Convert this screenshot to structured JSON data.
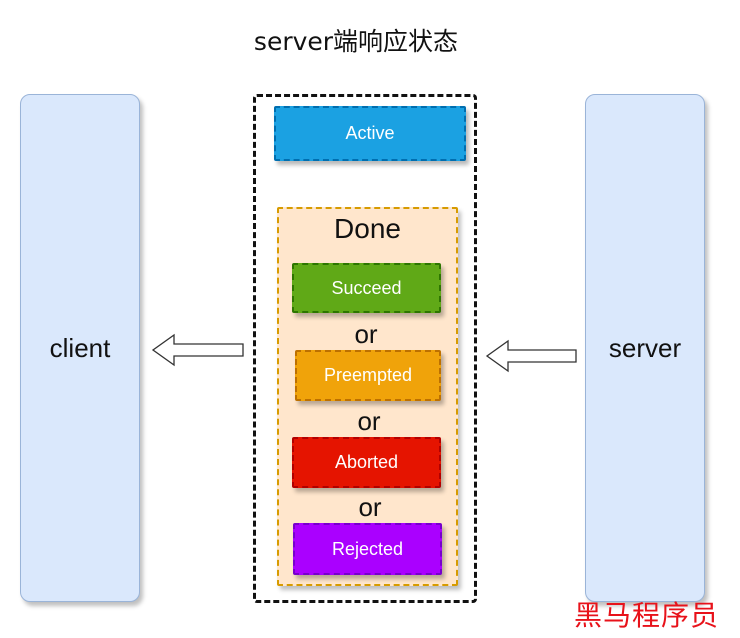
{
  "title": "server端响应状态",
  "client_label": "client",
  "server_label": "server",
  "active": {
    "label": "Active",
    "fill": "#1ba1e2",
    "border": "#006eaf"
  },
  "done": {
    "label": "Done",
    "states": [
      {
        "label": "Succeed",
        "fill": "#60a917",
        "border": "#2d7600"
      },
      {
        "label": "Preempted",
        "fill": "#f0a30a",
        "border": "#bd7000"
      },
      {
        "label": "Aborted",
        "fill": "#e51400",
        "border": "#b20000"
      },
      {
        "label": "Rejected",
        "fill": "#aa00ff",
        "border": "#7700cc"
      }
    ],
    "separator": "or"
  },
  "watermark": "黑马程序员"
}
